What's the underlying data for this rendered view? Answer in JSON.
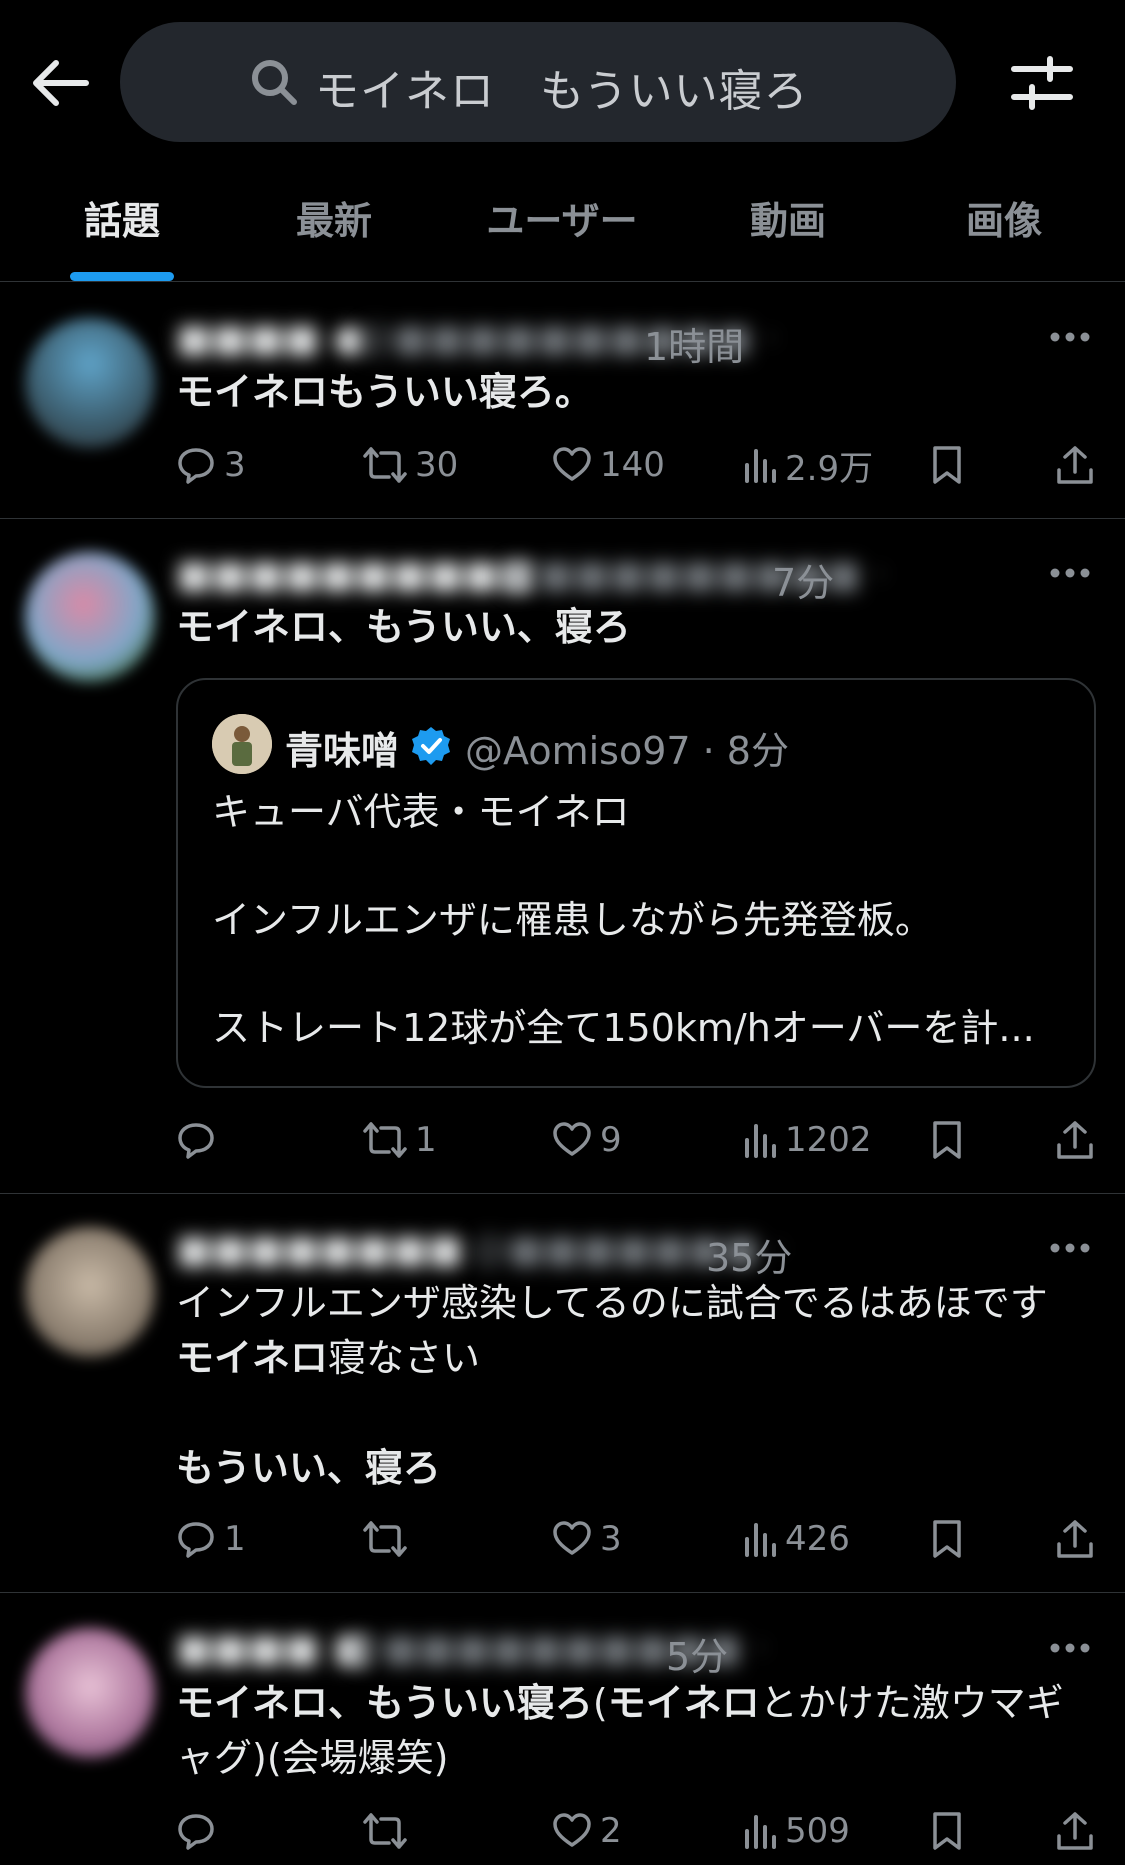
{
  "search": {
    "query": "モイネロ　もういい寝ろ"
  },
  "tabs": [
    {
      "label": "話題"
    },
    {
      "label": "最新"
    },
    {
      "label": "ユーザー"
    },
    {
      "label": "動画"
    },
    {
      "label": "画像"
    }
  ],
  "colors": {
    "accent": "#1d9bf0",
    "background": "#000000",
    "muted": "#8b9096"
  },
  "posts": [
    {
      "time": "1時間",
      "text_bold": "モイネロもういい寝ろ。",
      "replies": "3",
      "reposts": "30",
      "likes": "140",
      "views": "2.9万"
    },
    {
      "time": "7分",
      "text_bold": "モイネロ、もういい、寝ろ",
      "quote": {
        "name": "青味噌",
        "handle": "@Aomiso97 · 8分",
        "text": "キューバ代表・モイネロ\n\nインフルエンザに罹患しながら先発登板。\n\nストレート12球が全て150km/hオーバーを計..."
      },
      "replies": "",
      "reposts": "1",
      "likes": "9",
      "views": "1202"
    },
    {
      "time": "35分",
      "text_line1": "インフルエンザ感染してるのに試合でるはあほです",
      "text_bold2": "モイネロ",
      "text_line2_rest": "寝なさい",
      "text_bold3": "もういい、寝ろ",
      "replies": "1",
      "reposts": "",
      "likes": "3",
      "views": "426"
    },
    {
      "time": "5分",
      "text_bold_a": "モイネロ、もういい寝ろ",
      "text_plain_b": "(",
      "text_bold_c": "モイネロ",
      "text_plain_d": "とかけた激ウマギャグ)(会場爆笑)",
      "replies": "",
      "reposts": "",
      "likes": "2",
      "views": "509"
    }
  ]
}
